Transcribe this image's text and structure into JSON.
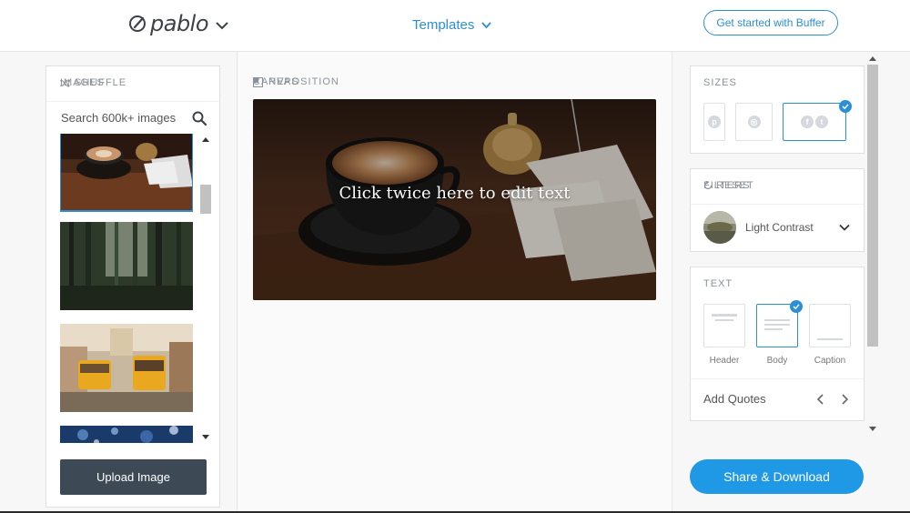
{
  "header": {
    "logo_text": "pablo",
    "templates_label": "Templates",
    "cta_label": "Get started with Buffer"
  },
  "images_panel": {
    "title": "IMAGES",
    "shuffle_label": "SHUFFLE",
    "search_placeholder": "Search 600k+ images",
    "thumbnails": [
      {
        "name": "coffee-cup-bell",
        "selected": true
      },
      {
        "name": "forest-trees",
        "selected": false
      },
      {
        "name": "lisbon-trams",
        "selected": false
      },
      {
        "name": "blue-bokeh",
        "selected": false
      }
    ],
    "upload_label": "Upload Image"
  },
  "canvas": {
    "title": "CANVAS",
    "reposition_label": "REPOSITION",
    "overlay_text": "Click twice here to edit text"
  },
  "sizes": {
    "title": "SIZES",
    "options": [
      {
        "name": "pinterest",
        "icons": [
          "pinterest-icon"
        ],
        "selected": false
      },
      {
        "name": "instagram",
        "icons": [
          "instagram-icon"
        ],
        "selected": false
      },
      {
        "name": "facebook-twitter",
        "icons": [
          "facebook-icon",
          "twitter-icon"
        ],
        "selected": true
      }
    ]
  },
  "filters": {
    "title": "FILTERS",
    "reset_label": "RESET",
    "selected_filter": "Light Contrast"
  },
  "text": {
    "title": "TEXT",
    "options": [
      {
        "label": "Header",
        "selected": false
      },
      {
        "label": "Body",
        "selected": true
      },
      {
        "label": "Caption",
        "selected": false
      }
    ],
    "add_quotes_label": "Add Quotes"
  },
  "share_label": "Share & Download",
  "colors": {
    "accent": "#2c8ed6",
    "share_button": "#1f98e6",
    "upload_button": "#3d4a55"
  }
}
